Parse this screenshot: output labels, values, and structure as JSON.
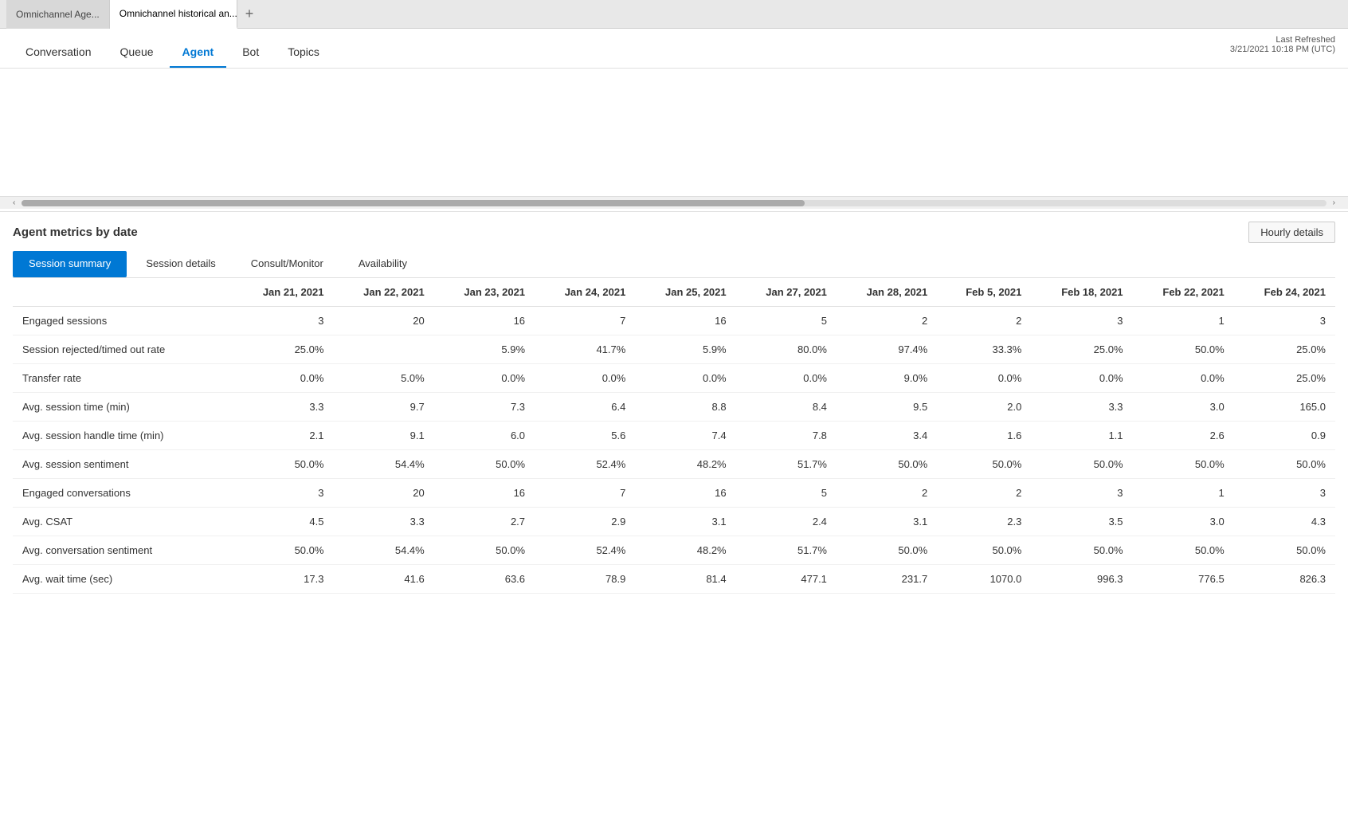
{
  "browser": {
    "tabs": [
      {
        "id": "tab1",
        "label": "Omnichannel Age...",
        "active": false
      },
      {
        "id": "tab2",
        "label": "Omnichannel historical an...",
        "active": true
      }
    ],
    "new_tab_icon": "+"
  },
  "top_nav": {
    "items": [
      {
        "id": "conversation",
        "label": "Conversation",
        "active": false
      },
      {
        "id": "queue",
        "label": "Queue",
        "active": false
      },
      {
        "id": "agent",
        "label": "Agent",
        "active": true
      },
      {
        "id": "bot",
        "label": "Bot",
        "active": false
      },
      {
        "id": "topics",
        "label": "Topics",
        "active": false
      }
    ],
    "last_refreshed_label": "Last Refreshed",
    "last_refreshed_value": "3/21/2021 10:18 PM (UTC)"
  },
  "metrics_section": {
    "title": "Agent metrics by date",
    "hourly_details_btn": "Hourly details",
    "sub_tabs": [
      {
        "id": "session_summary",
        "label": "Session summary",
        "active": true
      },
      {
        "id": "session_details",
        "label": "Session details",
        "active": false
      },
      {
        "id": "consult_monitor",
        "label": "Consult/Monitor",
        "active": false
      },
      {
        "id": "availability",
        "label": "Availability",
        "active": false
      }
    ],
    "table": {
      "columns": [
        "",
        "Jan 21, 2021",
        "Jan 22, 2021",
        "Jan 23, 2021",
        "Jan 24, 2021",
        "Jan 25, 2021",
        "Jan 27, 2021",
        "Jan 28, 2021",
        "Feb 5, 2021",
        "Feb 18, 2021",
        "Feb 22, 2021",
        "Feb 24, 2021"
      ],
      "rows": [
        {
          "label": "Engaged sessions",
          "values": [
            "3",
            "20",
            "16",
            "7",
            "16",
            "5",
            "2",
            "2",
            "3",
            "1",
            "3"
          ]
        },
        {
          "label": "Session rejected/timed out rate",
          "values": [
            "25.0%",
            "",
            "5.9%",
            "41.7%",
            "5.9%",
            "80.0%",
            "97.4%",
            "33.3%",
            "25.0%",
            "50.0%",
            "25.0%"
          ]
        },
        {
          "label": "Transfer rate",
          "values": [
            "0.0%",
            "5.0%",
            "0.0%",
            "0.0%",
            "0.0%",
            "0.0%",
            "9.0%",
            "0.0%",
            "0.0%",
            "0.0%",
            "25.0%"
          ]
        },
        {
          "label": "Avg. session time (min)",
          "values": [
            "3.3",
            "9.7",
            "7.3",
            "6.4",
            "8.8",
            "8.4",
            "9.5",
            "2.0",
            "3.3",
            "3.0",
            "165.0"
          ]
        },
        {
          "label": "Avg. session handle time (min)",
          "values": [
            "2.1",
            "9.1",
            "6.0",
            "5.6",
            "7.4",
            "7.8",
            "3.4",
            "1.6",
            "1.1",
            "2.6",
            "0.9"
          ]
        },
        {
          "label": "Avg. session sentiment",
          "values": [
            "50.0%",
            "54.4%",
            "50.0%",
            "52.4%",
            "48.2%",
            "51.7%",
            "50.0%",
            "50.0%",
            "50.0%",
            "50.0%",
            "50.0%"
          ]
        },
        {
          "label": "Engaged conversations",
          "values": [
            "3",
            "20",
            "16",
            "7",
            "16",
            "5",
            "2",
            "2",
            "3",
            "1",
            "3"
          ]
        },
        {
          "label": "Avg. CSAT",
          "values": [
            "4.5",
            "3.3",
            "2.7",
            "2.9",
            "3.1",
            "2.4",
            "3.1",
            "2.3",
            "3.5",
            "3.0",
            "4.3"
          ]
        },
        {
          "label": "Avg. conversation sentiment",
          "values": [
            "50.0%",
            "54.4%",
            "50.0%",
            "52.4%",
            "48.2%",
            "51.7%",
            "50.0%",
            "50.0%",
            "50.0%",
            "50.0%",
            "50.0%"
          ]
        },
        {
          "label": "Avg. wait time (sec)",
          "values": [
            "17.3",
            "41.6",
            "63.6",
            "78.9",
            "81.4",
            "477.1",
            "231.7",
            "1070.0",
            "996.3",
            "776.5",
            "826.3"
          ]
        }
      ]
    }
  }
}
